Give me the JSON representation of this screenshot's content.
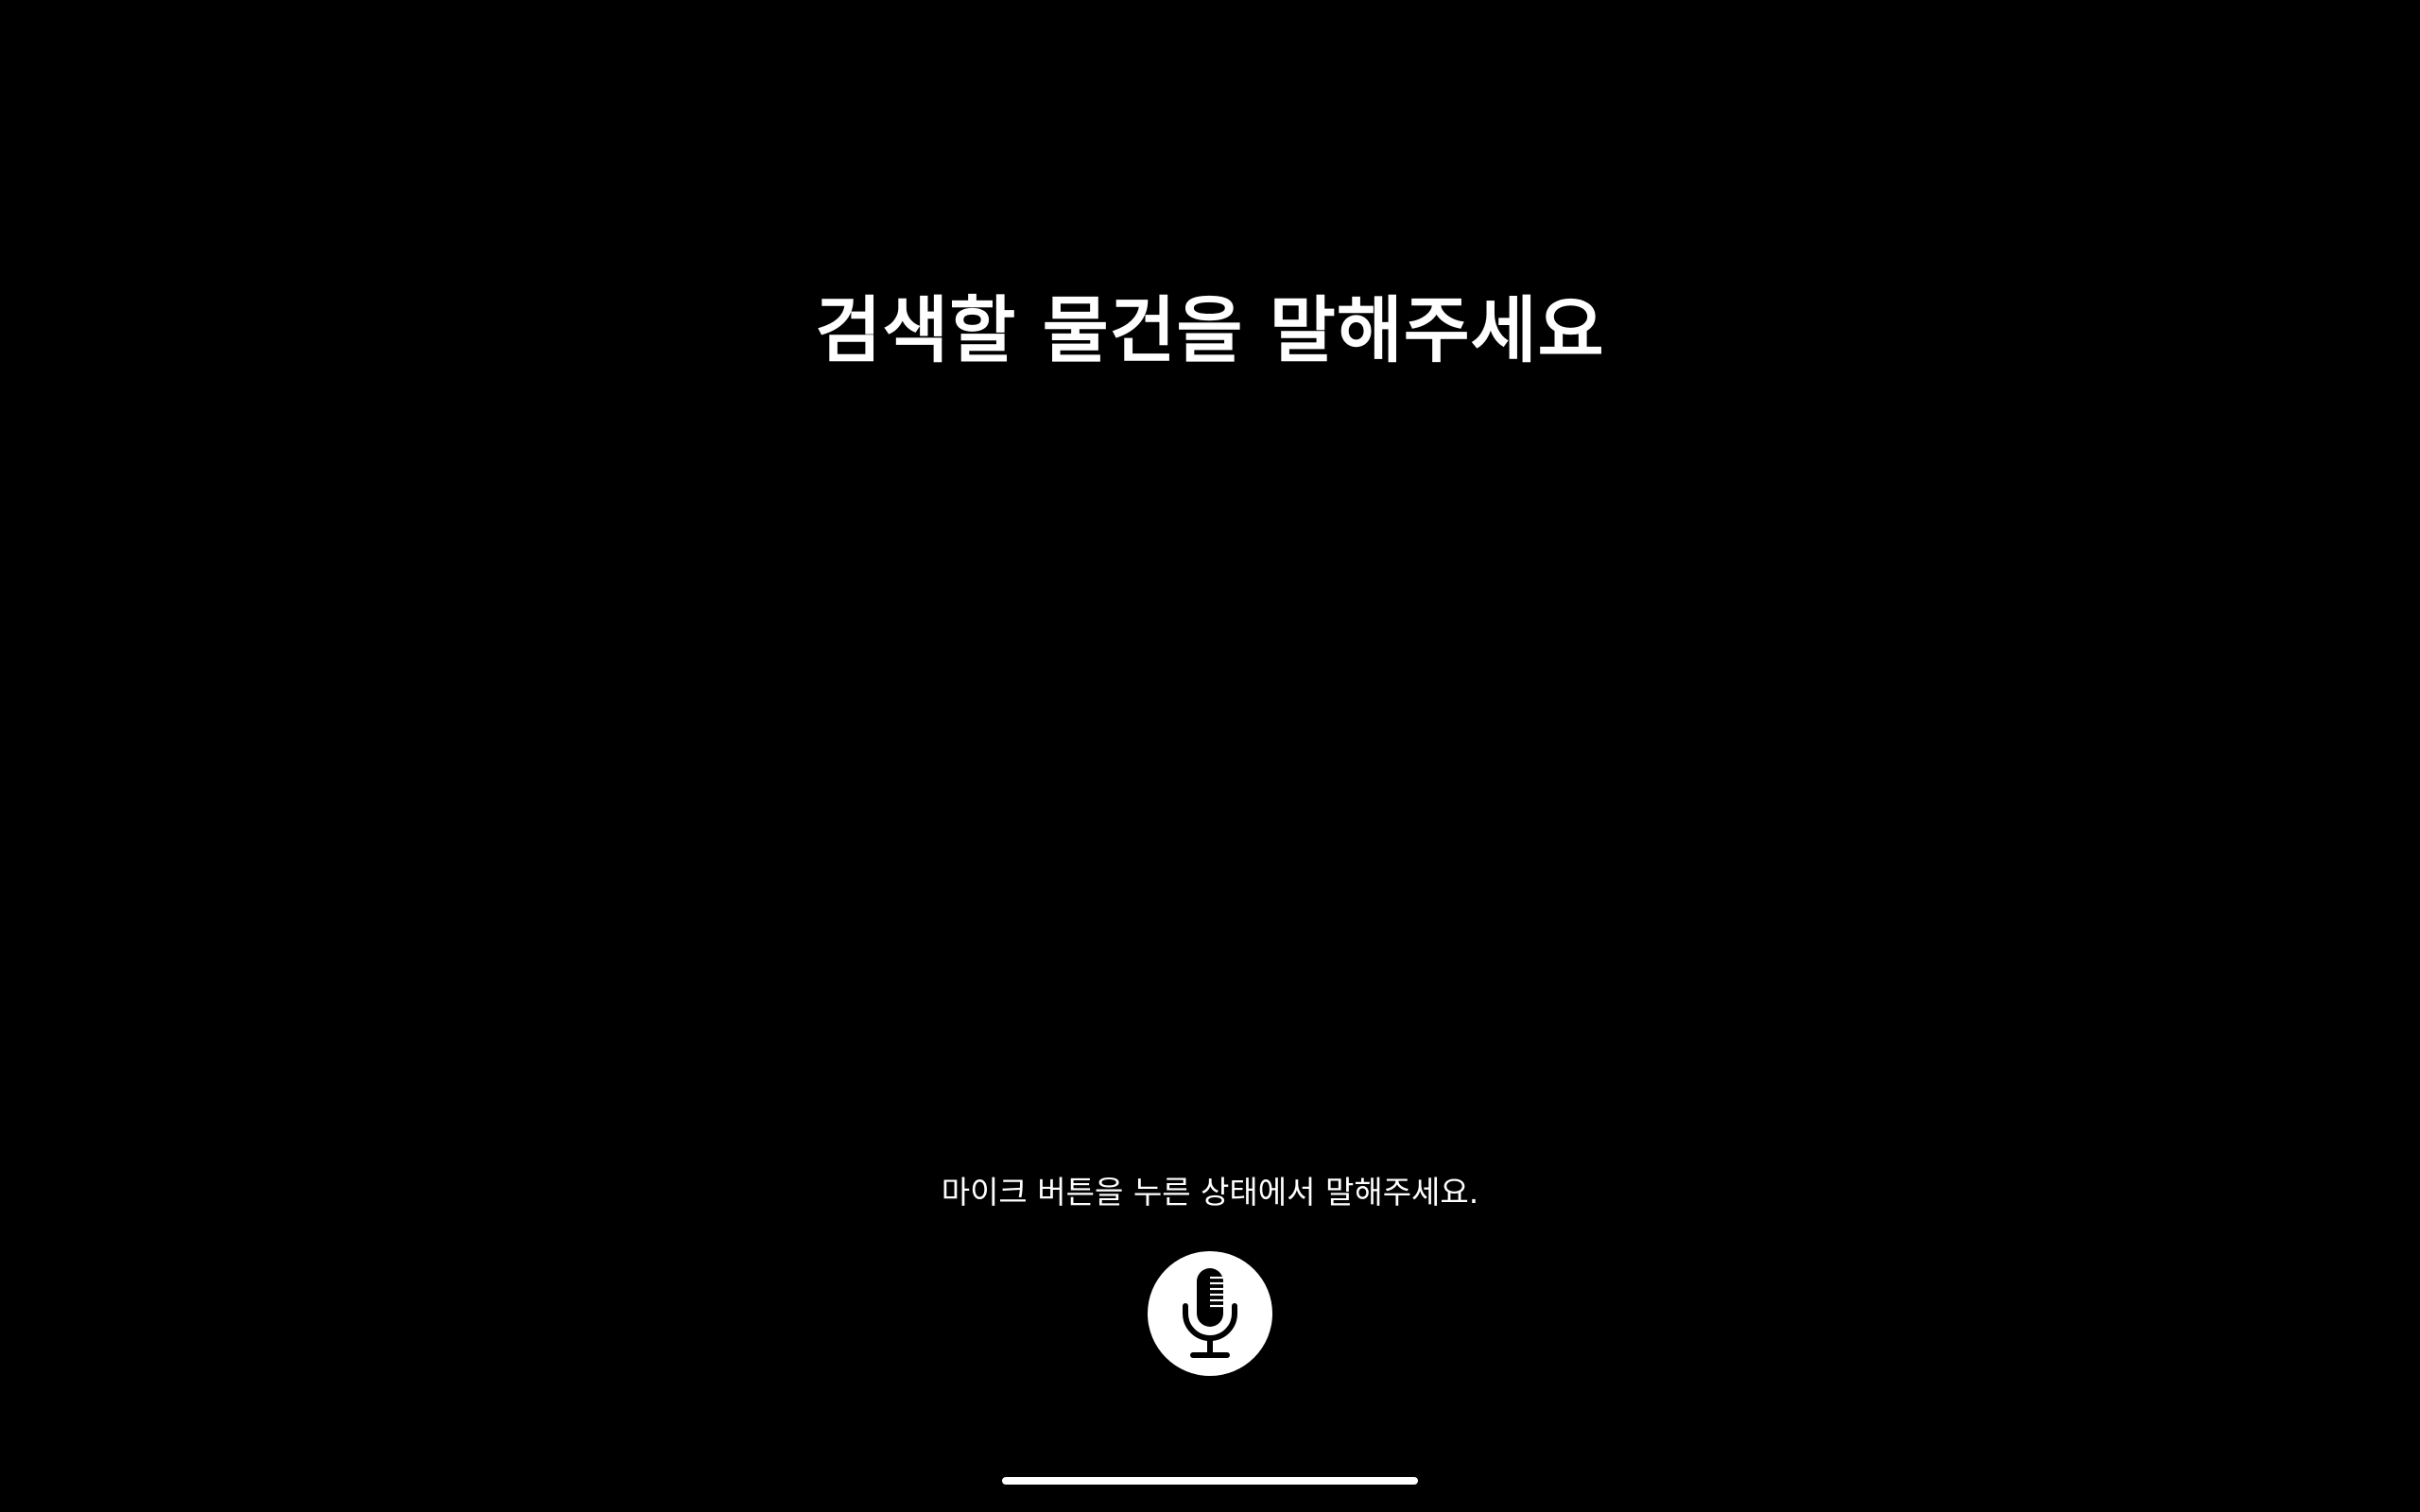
{
  "prompt": {
    "title": "검색할 물건을 말해주세요",
    "hint": "마이크 버튼을 누른 상태에서 말해주세요."
  },
  "mic_button": {
    "icon": "microphone-icon",
    "background_color": "#ffffff",
    "icon_color": "#000000"
  },
  "colors": {
    "background": "#000000",
    "text": "#ffffff"
  }
}
